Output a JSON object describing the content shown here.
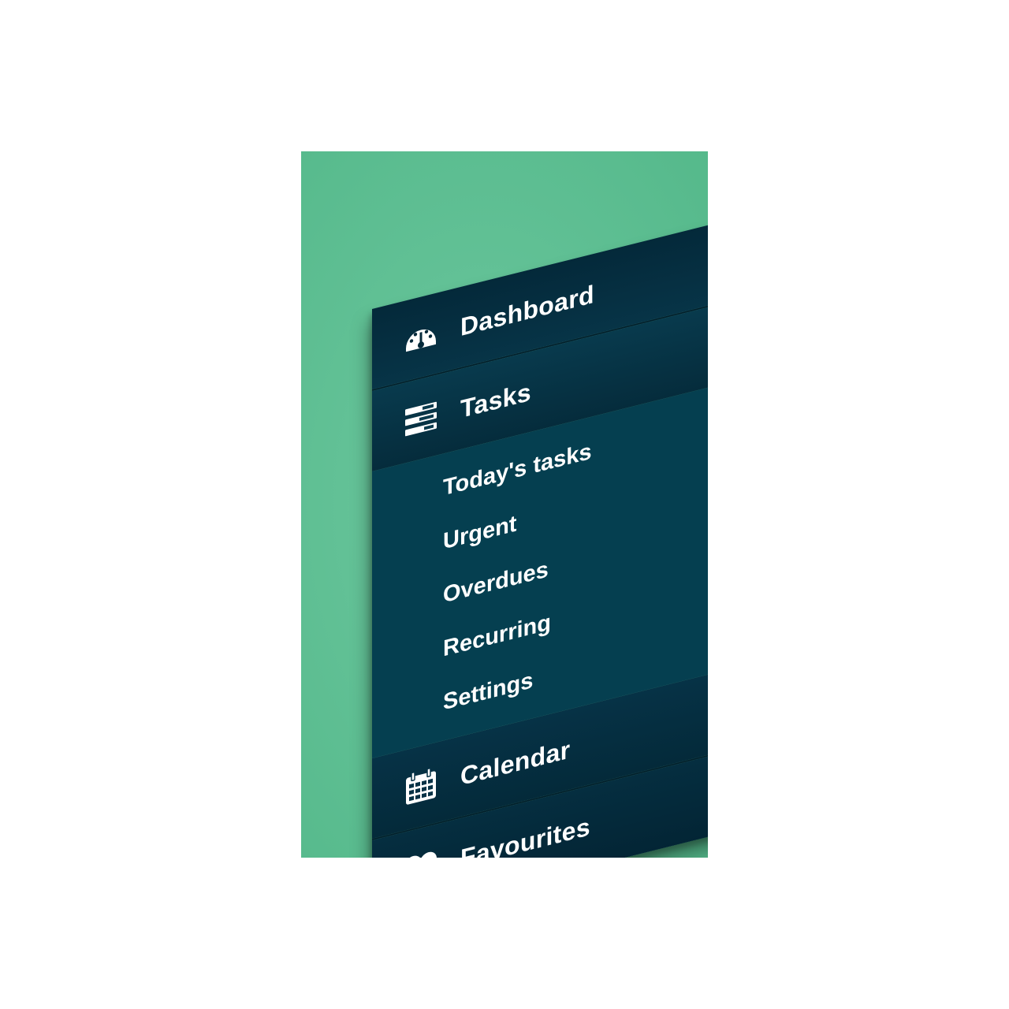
{
  "menu": {
    "dashboard": {
      "label": "Dashboard",
      "icon": "dashboard-gauge-icon"
    },
    "tasks": {
      "label": "Tasks",
      "icon": "tasks-list-icon",
      "subitems": [
        "Today's tasks",
        "Urgent",
        "Overdues",
        "Recurring",
        "Settings"
      ]
    },
    "calendar": {
      "label": "Calendar",
      "icon": "calendar-icon"
    },
    "favourites": {
      "label": "Favourites",
      "icon": "heart-icon"
    }
  },
  "colors": {
    "background": "#62c196",
    "menu_dark": "#04293a",
    "submenu": "#053f50",
    "text": "#ffffff"
  }
}
